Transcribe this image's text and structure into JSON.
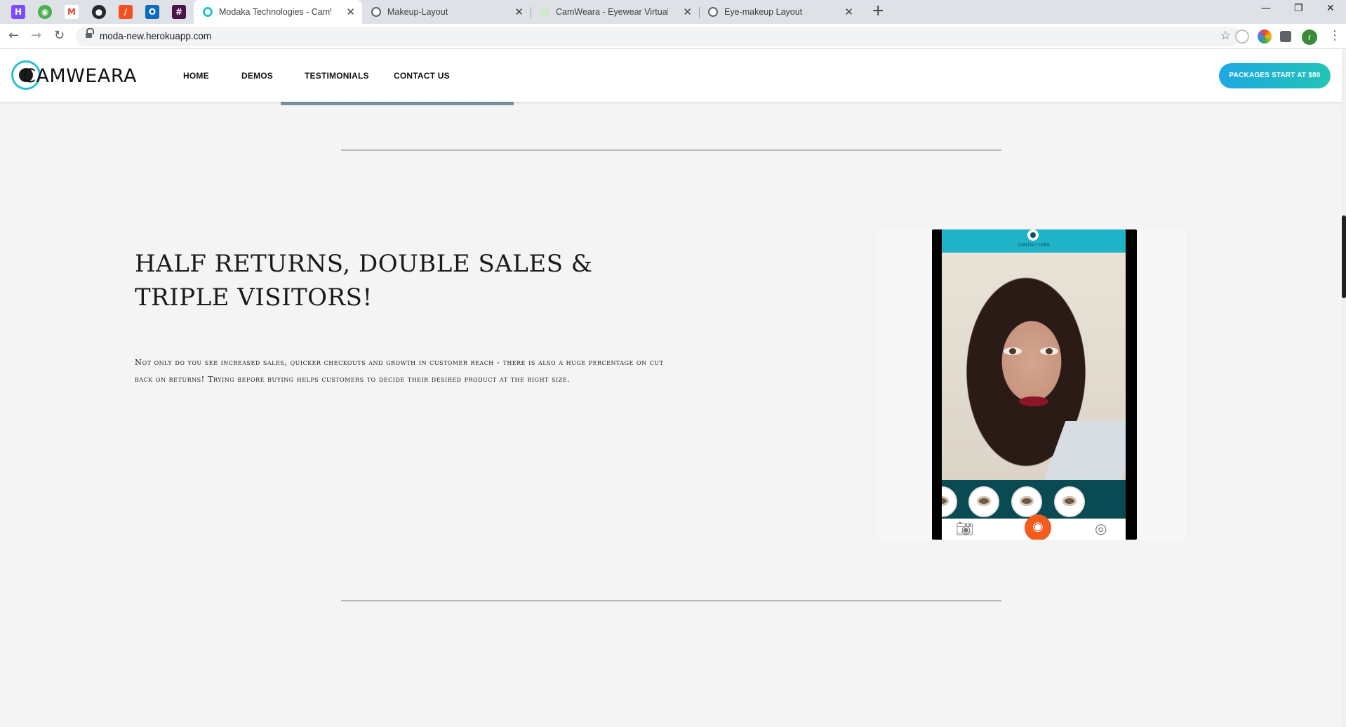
{
  "browser": {
    "pinned_tabs": [
      {
        "icon": "h-square-icon",
        "letter": "H",
        "color": "#7c4dff"
      },
      {
        "icon": "cat-eye-icon",
        "letter": "◉",
        "color": "#4caf50"
      },
      {
        "icon": "gmail-icon",
        "letter": "M",
        "color": "#ea4335"
      },
      {
        "icon": "github-icon",
        "letter": "●",
        "color": "#24292e"
      },
      {
        "icon": "diagonal-icon",
        "letter": "/",
        "color": "#f4511e"
      },
      {
        "icon": "outlook-icon",
        "letter": "O",
        "color": "#0f6cbd"
      },
      {
        "icon": "grid-icon",
        "letter": "#",
        "color": "#4a154b"
      }
    ],
    "tabs": [
      {
        "title": "Modaka Technologies - CamWeara",
        "active": true
      },
      {
        "title": "Makeup-Layout",
        "active": false
      },
      {
        "title": "CamWeara - Eyewear Virtual Try",
        "active": false
      },
      {
        "title": "Eye-makeup Layout",
        "active": false
      }
    ],
    "url": "moda-new.herokuapp.com",
    "profile_initial": "r"
  },
  "site": {
    "logo_text": "AMWEARA",
    "nav": [
      {
        "label": "HOME"
      },
      {
        "label": "DEMOS"
      },
      {
        "label": "TESTIMONIALS"
      },
      {
        "label": "CONTACT US"
      }
    ],
    "cta_label": "PACKAGES START AT $80"
  },
  "section": {
    "headline": "HALF RETURNS, DOUBLE SALES & TRIPLE VISITORS!",
    "body": "Not only do you see increased sales, quicker checkouts and growth in customer reach - there is also a huge percentage on cut back on returns! Trying before buying helps customers to decide their desired product at the right size."
  },
  "phone_app": {
    "title": "CONTACT LENS",
    "accent": "#1fb3c8",
    "shutter_color": "#f25c1e"
  }
}
